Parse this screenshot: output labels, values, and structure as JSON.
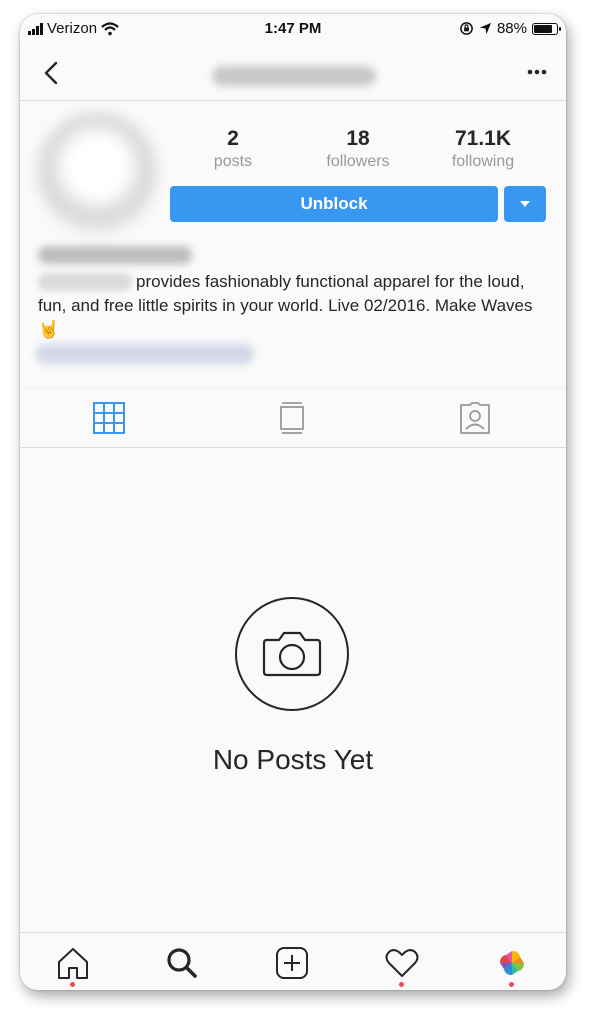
{
  "status_bar": {
    "carrier": "Verizon",
    "time": "1:47 PM",
    "battery_percent": "88%",
    "battery_level": 0.88
  },
  "profile": {
    "stats": [
      {
        "value": "2",
        "label": "posts"
      },
      {
        "value": "18",
        "label": "followers"
      },
      {
        "value": "71.1K",
        "label": "following"
      }
    ],
    "unblock_label": "Unblock",
    "bio_visible": "provides fashionably functional apparel for the loud, fun, and free little spirits in your world. Live 02/2016. Make Waves 🤘"
  },
  "empty_state": {
    "text": "No Posts Yet"
  },
  "colors": {
    "accent": "#3897f0",
    "notification_dot": "#ed4956",
    "text": "#262626",
    "muted": "#999999"
  },
  "icons": {
    "back": "chevron-left-icon",
    "more": "more-icon",
    "grid": "grid-icon",
    "feed": "feed-icon",
    "tagged": "tagged-icon",
    "camera": "camera-icon",
    "home": "home-icon",
    "search": "search-icon",
    "add": "add-post-icon",
    "heart": "heart-icon",
    "photos": "photos-icon"
  }
}
